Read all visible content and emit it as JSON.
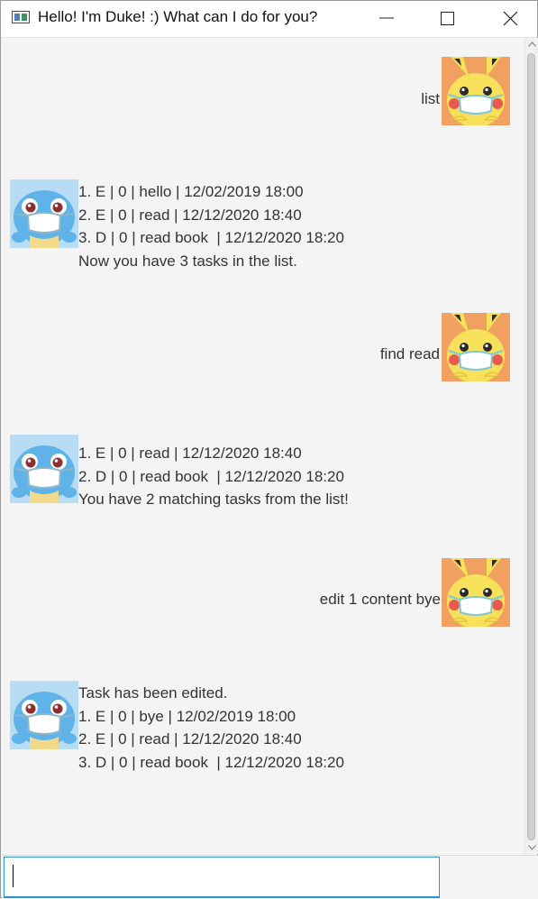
{
  "window": {
    "title": "Hello! I'm Duke! :) What can I do for you?",
    "controls": {
      "minimize_icon": "minimize-icon",
      "maximize_icon": "maximize-icon",
      "close_icon": "close-icon"
    }
  },
  "colors": {
    "chat_background": "#f4f4f4",
    "user_avatar_bg": "#f0a060",
    "duke_avatar_bg": "#b9dcf5",
    "input_focus_border": "#2f8fd8",
    "text": "#333333"
  },
  "conversation": [
    {
      "speaker": "user",
      "avatar": "pikachu-avatar",
      "text": "list"
    },
    {
      "speaker": "duke",
      "avatar": "squirtle-avatar",
      "lines": [
        "1. E | 0 | hello | 12/02/2019 18:00",
        "2. E | 0 | read | 12/12/2020 18:40",
        "3. D | 0 | read book  | 12/12/2020 18:20",
        "Now you have 3 tasks in the list."
      ]
    },
    {
      "speaker": "user",
      "avatar": "pikachu-avatar",
      "text": "find read"
    },
    {
      "speaker": "duke",
      "avatar": "squirtle-avatar",
      "lines": [
        "1. E | 0 | read | 12/12/2020 18:40",
        "2. D | 0 | read book  | 12/12/2020 18:20",
        "You have 2 matching tasks from the list!"
      ]
    },
    {
      "speaker": "user",
      "avatar": "pikachu-avatar",
      "text": "edit 1 content bye"
    },
    {
      "speaker": "duke",
      "avatar": "squirtle-avatar",
      "lines": [
        "Task has been edited.",
        "1. E | 0 | bye | 12/02/2019 18:00",
        "2. E | 0 | read | 12/12/2020 18:40",
        "3. D | 0 | read book  | 12/12/2020 18:20"
      ]
    }
  ],
  "input": {
    "value": "",
    "placeholder": ""
  }
}
